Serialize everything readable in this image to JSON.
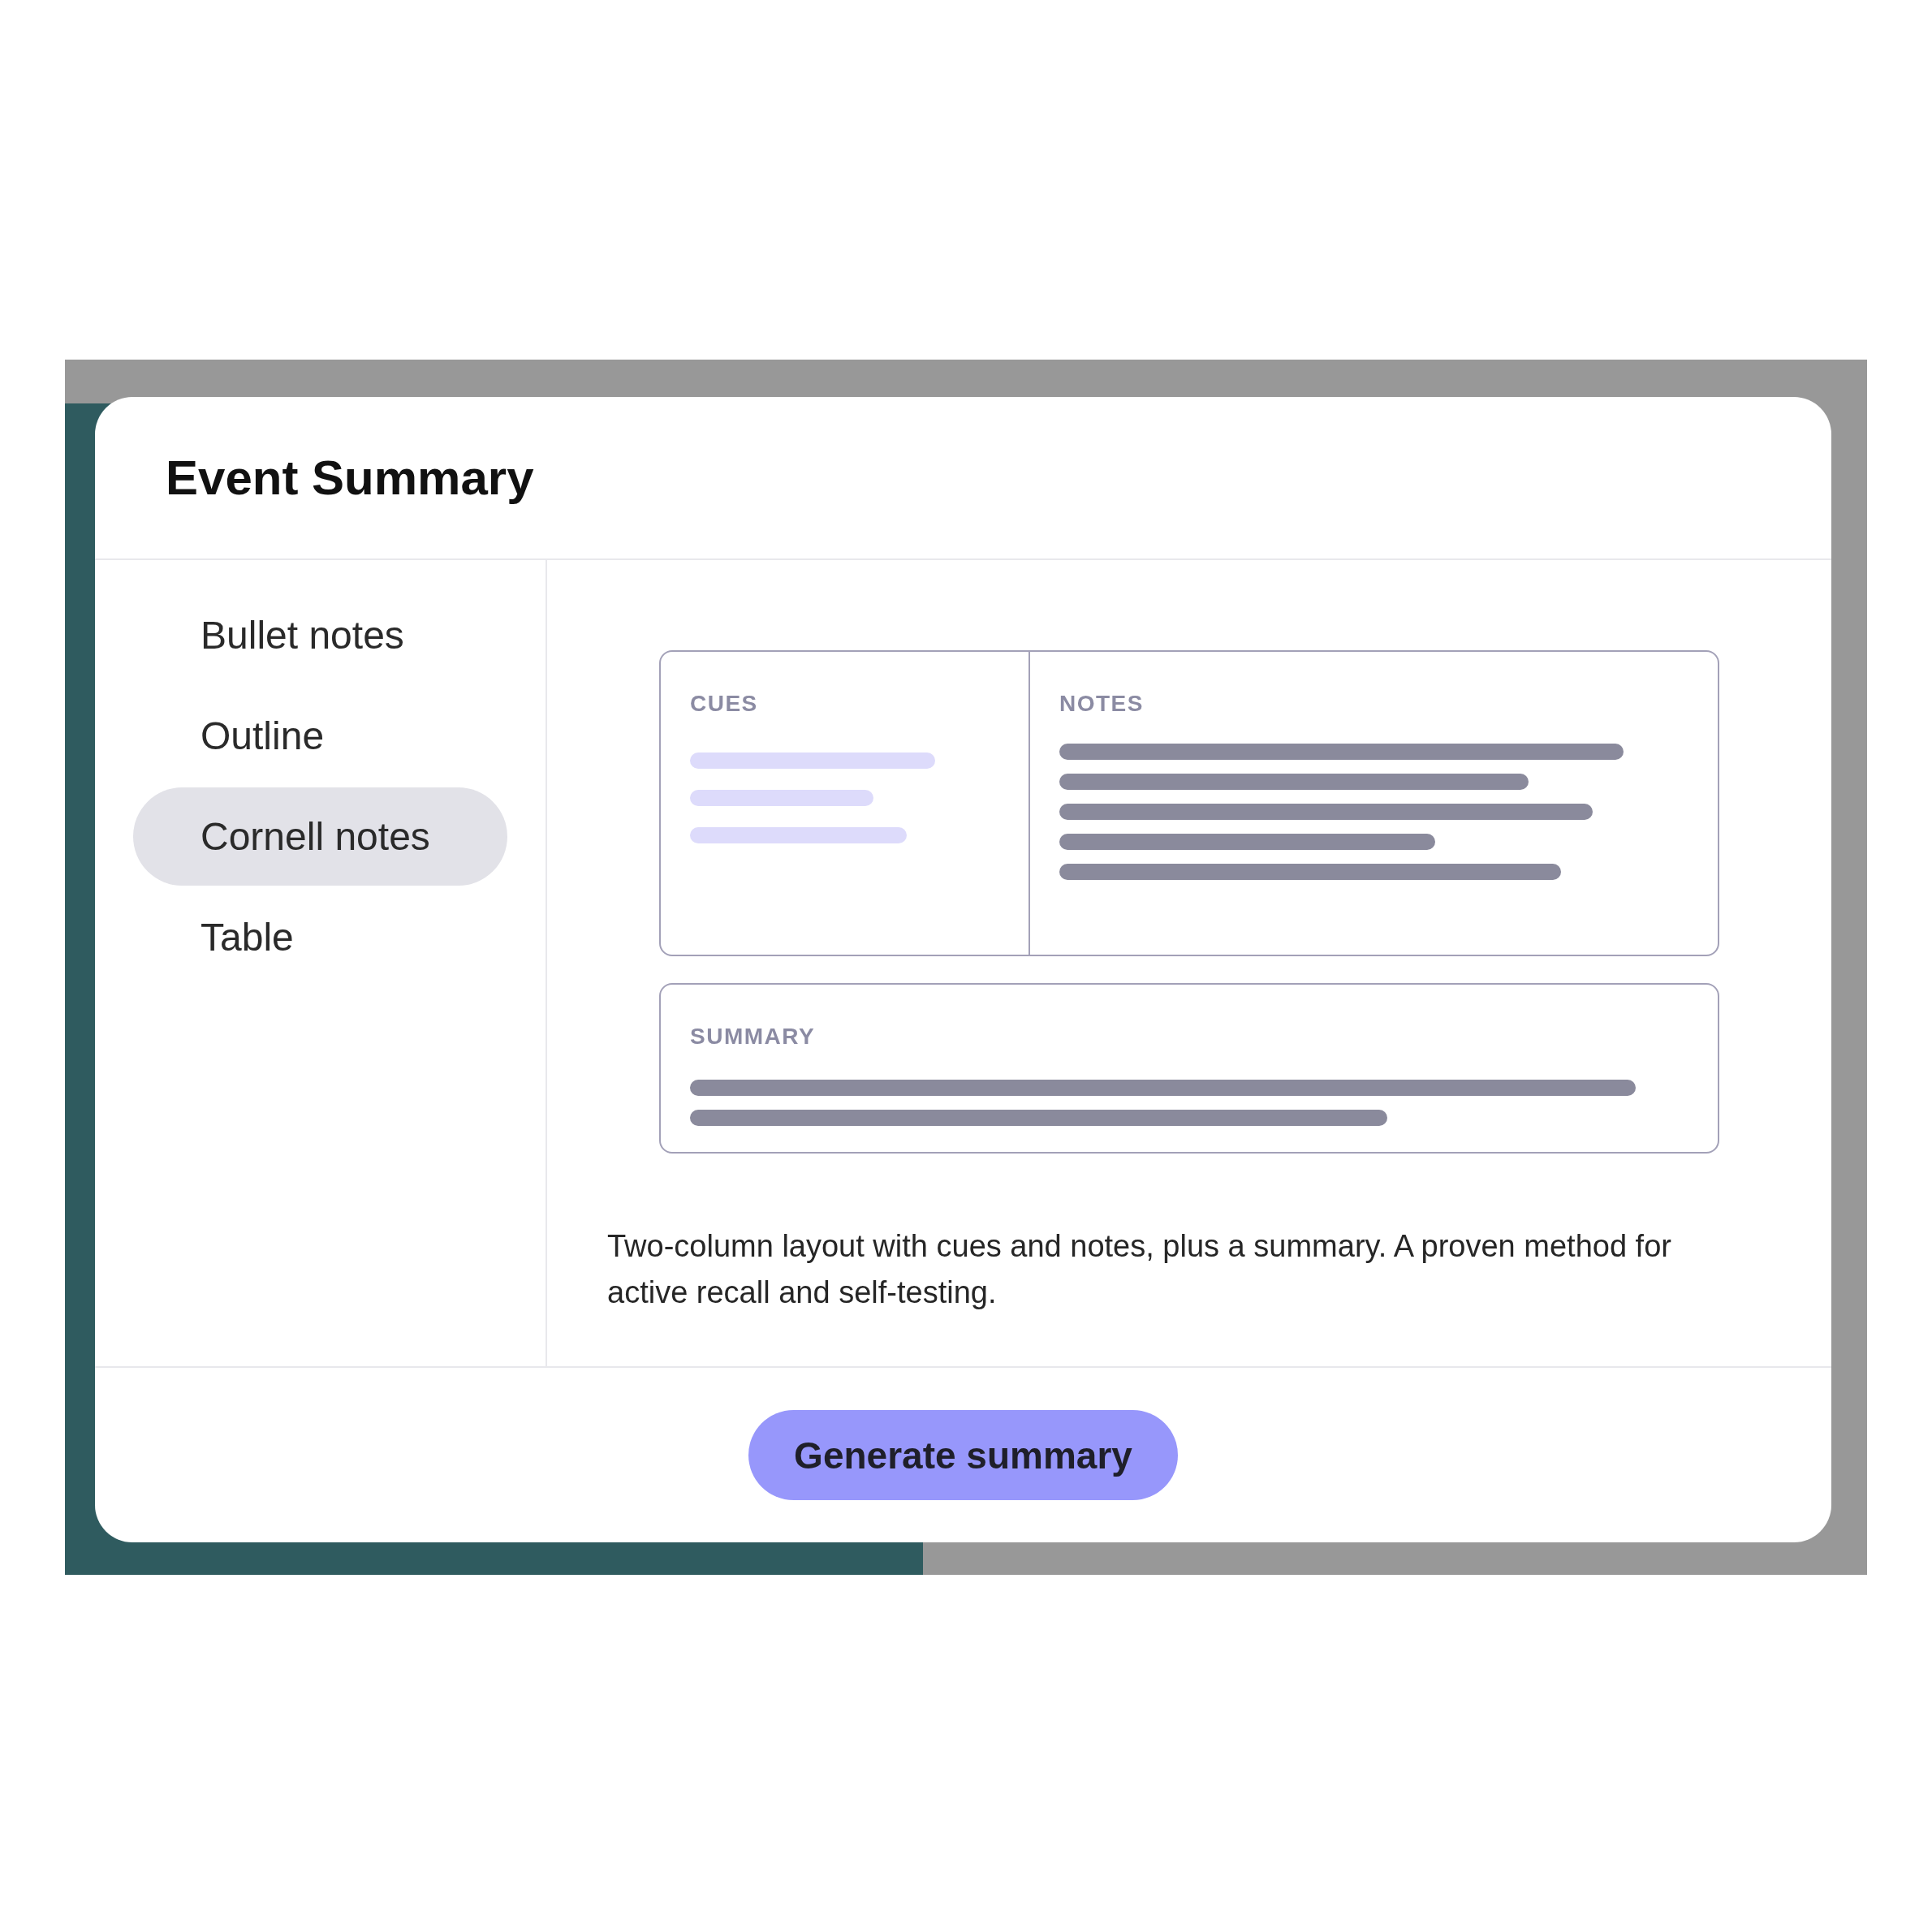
{
  "dialog": {
    "title": "Event Summary"
  },
  "formats": [
    {
      "label": "Bullet notes",
      "selected": false
    },
    {
      "label": "Outline",
      "selected": false
    },
    {
      "label": "Cornell notes",
      "selected": true
    },
    {
      "label": "Table",
      "selected": false
    }
  ],
  "preview": {
    "cues_label": "CUES",
    "notes_label": "NOTES",
    "summary_label": "SUMMARY"
  },
  "description": "Two-column layout with cues and notes, plus a summary. A proven method for active recall and self-testing.",
  "primary_button": {
    "label": "Generate summary"
  }
}
